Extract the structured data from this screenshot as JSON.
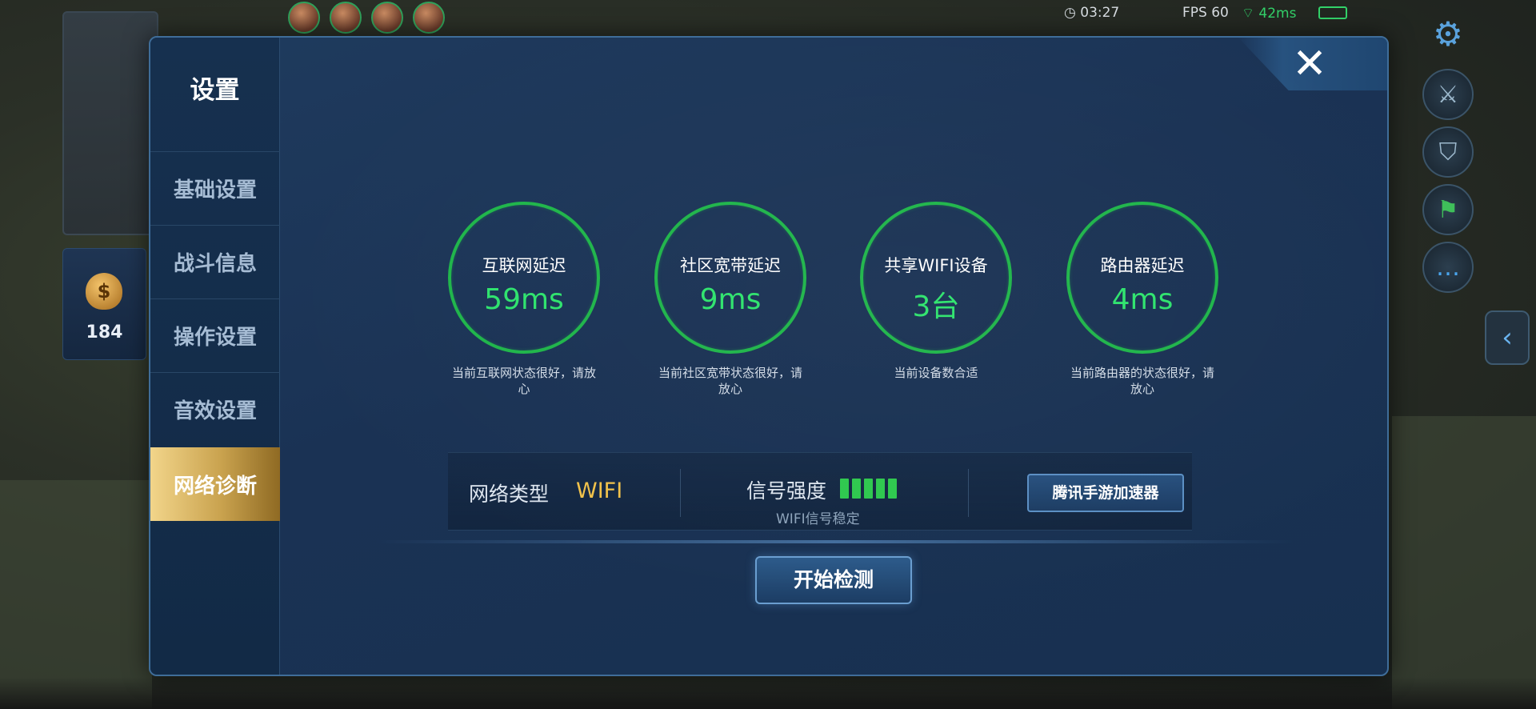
{
  "hud": {
    "time": "03:27",
    "fps": "FPS 60",
    "ping": "42ms",
    "gold": "184",
    "gold_icon": "money-bag-icon"
  },
  "dialog": {
    "title": "设置",
    "close_icon": "close-icon",
    "sidebar": [
      {
        "label": "基础设置",
        "active": false
      },
      {
        "label": "战斗信息",
        "active": false
      },
      {
        "label": "操作设置",
        "active": false
      },
      {
        "label": "音效设置",
        "active": false
      },
      {
        "label": "网络诊断",
        "active": true
      }
    ],
    "metrics": [
      {
        "label": "互联网延迟",
        "value": "59ms",
        "desc": "当前互联网状态很好，请放心"
      },
      {
        "label": "社区宽带延迟",
        "value": "9ms",
        "desc": "当前社区宽带状态很好，请放心"
      },
      {
        "label": "共享WIFI设备",
        "value": "3台",
        "desc": "当前设备数合适"
      },
      {
        "label": "路由器延迟",
        "value": "4ms",
        "desc": "当前路由器的状态很好，请放心"
      }
    ],
    "network_type_label": "网络类型",
    "network_type_value": "WIFI",
    "signal_label": "信号强度",
    "signal_bars": 5,
    "signal_note": "WIFI信号稳定",
    "accelerator_button": "腾讯手游加速器",
    "start_button": "开始检测"
  },
  "colors": {
    "accent_green": "#2ee36d",
    "ring_green": "#1fb54a",
    "wifi_yellow": "#f1c24a",
    "active_tab_gold": "#c9a24e"
  }
}
